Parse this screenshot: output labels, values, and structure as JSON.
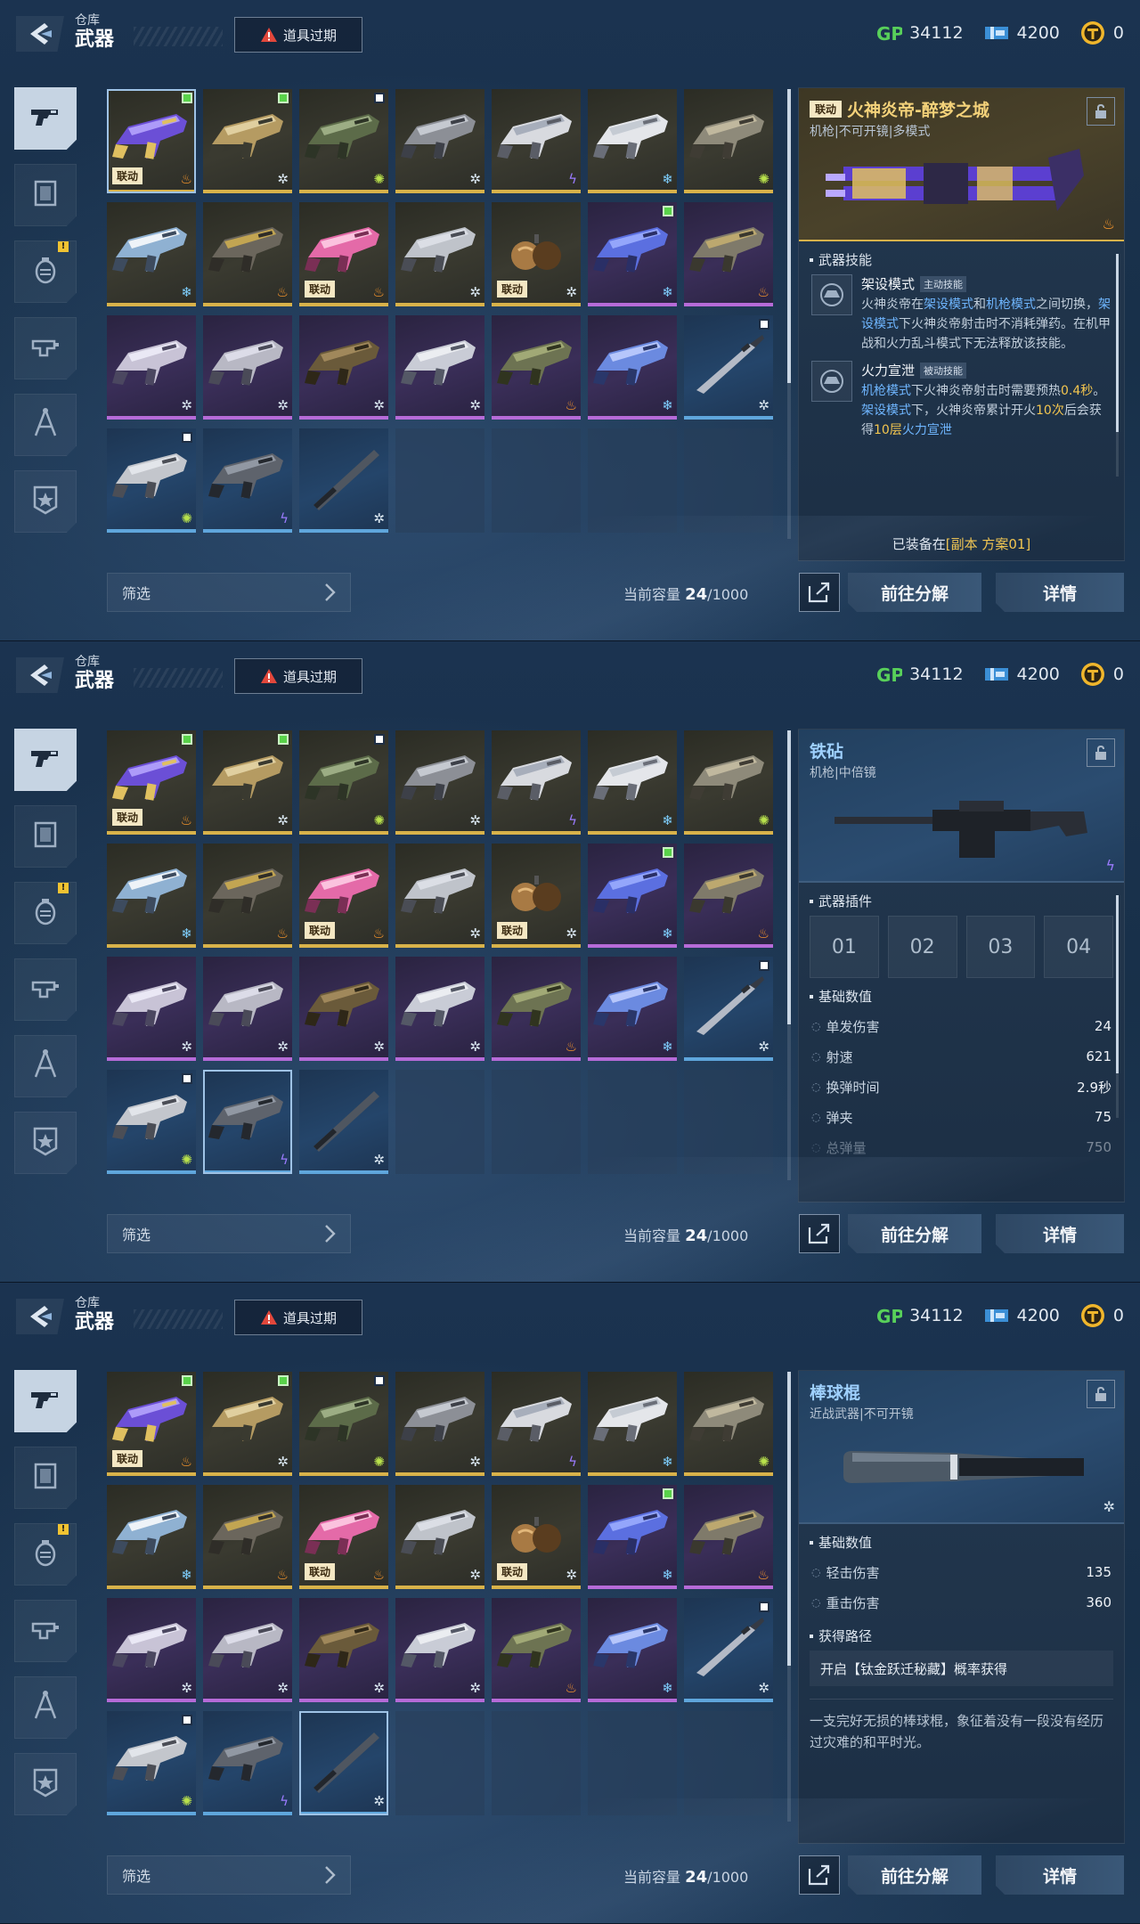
{
  "header": {
    "subtitle": "仓库",
    "title": "武器",
    "alert_label": "道具过期",
    "currencies": [
      {
        "icon": "gp-icon",
        "value": "34112"
      },
      {
        "icon": "ticket-icon",
        "value": "4200"
      },
      {
        "icon": "coin-icon",
        "value": "0"
      }
    ]
  },
  "sidebar": {
    "items": [
      {
        "icon": "pistol-icon",
        "active": true,
        "badge": ""
      },
      {
        "icon": "armor-icon",
        "active": false,
        "badge": ""
      },
      {
        "icon": "grenade-icon",
        "active": false,
        "badge": "!"
      },
      {
        "icon": "module-icon",
        "active": false,
        "badge": ""
      },
      {
        "icon": "compass-icon",
        "active": false,
        "badge": ""
      },
      {
        "icon": "star-badge-icon",
        "active": false,
        "badge": ""
      }
    ]
  },
  "tiles": [
    {
      "rarity": "gold",
      "mark": "green",
      "collab": true,
      "elem": "fire"
    },
    {
      "rarity": "gold",
      "mark": "green",
      "collab": false,
      "elem": "frost"
    },
    {
      "rarity": "gold",
      "mark": "white",
      "collab": false,
      "elem": "poison"
    },
    {
      "rarity": "gold",
      "mark": "",
      "collab": false,
      "elem": "frost"
    },
    {
      "rarity": "gold",
      "mark": "",
      "collab": false,
      "elem": "volt"
    },
    {
      "rarity": "gold",
      "mark": "",
      "collab": false,
      "elem": "ice"
    },
    {
      "rarity": "gold",
      "mark": "",
      "collab": false,
      "elem": "poison"
    },
    {
      "rarity": "gold",
      "mark": "",
      "collab": false,
      "elem": "ice"
    },
    {
      "rarity": "gold",
      "mark": "",
      "collab": false,
      "elem": "fire"
    },
    {
      "rarity": "gold",
      "mark": "",
      "collab": true,
      "elem": "fire"
    },
    {
      "rarity": "gold",
      "mark": "",
      "collab": false,
      "elem": "frost"
    },
    {
      "rarity": "gold",
      "mark": "",
      "collab": true,
      "elem": "frost"
    },
    {
      "rarity": "purple",
      "mark": "green",
      "collab": false,
      "elem": "ice"
    },
    {
      "rarity": "purple",
      "mark": "",
      "collab": false,
      "elem": "fire"
    },
    {
      "rarity": "purple",
      "mark": "",
      "collab": false,
      "elem": "frost"
    },
    {
      "rarity": "purple",
      "mark": "",
      "collab": false,
      "elem": "frost"
    },
    {
      "rarity": "purple",
      "mark": "",
      "collab": false,
      "elem": "frost"
    },
    {
      "rarity": "purple",
      "mark": "",
      "collab": false,
      "elem": "frost"
    },
    {
      "rarity": "purple",
      "mark": "",
      "collab": false,
      "elem": "fire"
    },
    {
      "rarity": "purple",
      "mark": "",
      "collab": false,
      "elem": "ice"
    },
    {
      "rarity": "blue",
      "mark": "white",
      "collab": false,
      "elem": "frost"
    },
    {
      "rarity": "blue",
      "mark": "white",
      "collab": false,
      "elem": "poison"
    },
    {
      "rarity": "blue",
      "mark": "",
      "collab": false,
      "elem": "volt"
    },
    {
      "rarity": "blue",
      "mark": "",
      "collab": false,
      "elem": "frost"
    }
  ],
  "collab_label": "联动",
  "filter_label": "筛选",
  "capacity": {
    "label": "当前容量",
    "used": "24",
    "total": "/1000"
  },
  "buttons": {
    "decompose": "前往分解",
    "detail": "详情"
  },
  "panels": [
    {
      "selected_index": 0,
      "detail": {
        "type": "skills",
        "collab": "联动",
        "name": "火神炎帝-醉梦之城",
        "subtitle": "机枪|不可开镜|多模式",
        "rarity": "gold",
        "elem": "fire",
        "section_title": "武器技能",
        "skills": [
          {
            "name": "架设模式",
            "tag": "主动技能",
            "desc_parts": [
              {
                "t": "火神炎帝在",
                "c": ""
              },
              {
                "t": "架设模式",
                "c": "b"
              },
              {
                "t": "和",
                "c": ""
              },
              {
                "t": "机枪模式",
                "c": "b"
              },
              {
                "t": "之间切换，",
                "c": ""
              },
              {
                "t": "架设模式",
                "c": "b"
              },
              {
                "t": "下火神炎帝射击时不消耗弹药。在机甲战和火力乱斗模式下无法释放该技能。",
                "c": ""
              }
            ]
          },
          {
            "name": "火力宣泄",
            "tag": "被动技能",
            "desc_parts": [
              {
                "t": "机枪模式",
                "c": "b"
              },
              {
                "t": "下火神炎帝射击时需要预热",
                "c": ""
              },
              {
                "t": "0.4秒",
                "c": "y"
              },
              {
                "t": "。",
                "c": ""
              },
              {
                "t": "架设模式",
                "c": "b"
              },
              {
                "t": "下，火神炎帝累计开火",
                "c": ""
              },
              {
                "t": "10次",
                "c": "y"
              },
              {
                "t": "后会获得",
                "c": ""
              },
              {
                "t": "10层",
                "c": "y"
              },
              {
                "t": "火力宣泄",
                "c": "b"
              }
            ]
          }
        ],
        "equipped_prefix": "已装备在",
        "equipped_value": "[副本 方案01]"
      }
    },
    {
      "selected_index": 22,
      "detail": {
        "type": "plugins",
        "name": "铁砧",
        "subtitle": "机枪|中倍镜",
        "rarity": "blue",
        "elem": "volt",
        "plugins_title": "武器插件",
        "plugins": [
          "01",
          "02",
          "03",
          "04"
        ],
        "stats_title": "基础数值",
        "stats": [
          {
            "label": "单发伤害",
            "value": "24"
          },
          {
            "label": "射速",
            "value": "621"
          },
          {
            "label": "换弹时间",
            "value": "2.9秒"
          },
          {
            "label": "弹夹",
            "value": "75"
          },
          {
            "label": "总弹量",
            "value": "750"
          }
        ]
      }
    },
    {
      "selected_index": 23,
      "detail": {
        "type": "melee",
        "name": "棒球棍",
        "subtitle": "近战武器|不可开镜",
        "rarity": "blue",
        "elem": "frost",
        "stats_title": "基础数值",
        "stats": [
          {
            "label": "轻击伤害",
            "value": "135"
          },
          {
            "label": "重击伤害",
            "value": "360"
          }
        ],
        "obtain_title": "获得路径",
        "obtain_text": "开启【钛金跃迁秘藏】概率获得",
        "lore": "一支完好无损的棒球棍，象征着没有一段没有经历过灾难的和平时光。"
      }
    }
  ],
  "colors": {
    "gold": "#d8b24a",
    "purple": "#b66bd8",
    "blue": "#5fa6dc",
    "accent_yellow": "#f3c64f",
    "accent_blue": "#6fb6ff"
  }
}
